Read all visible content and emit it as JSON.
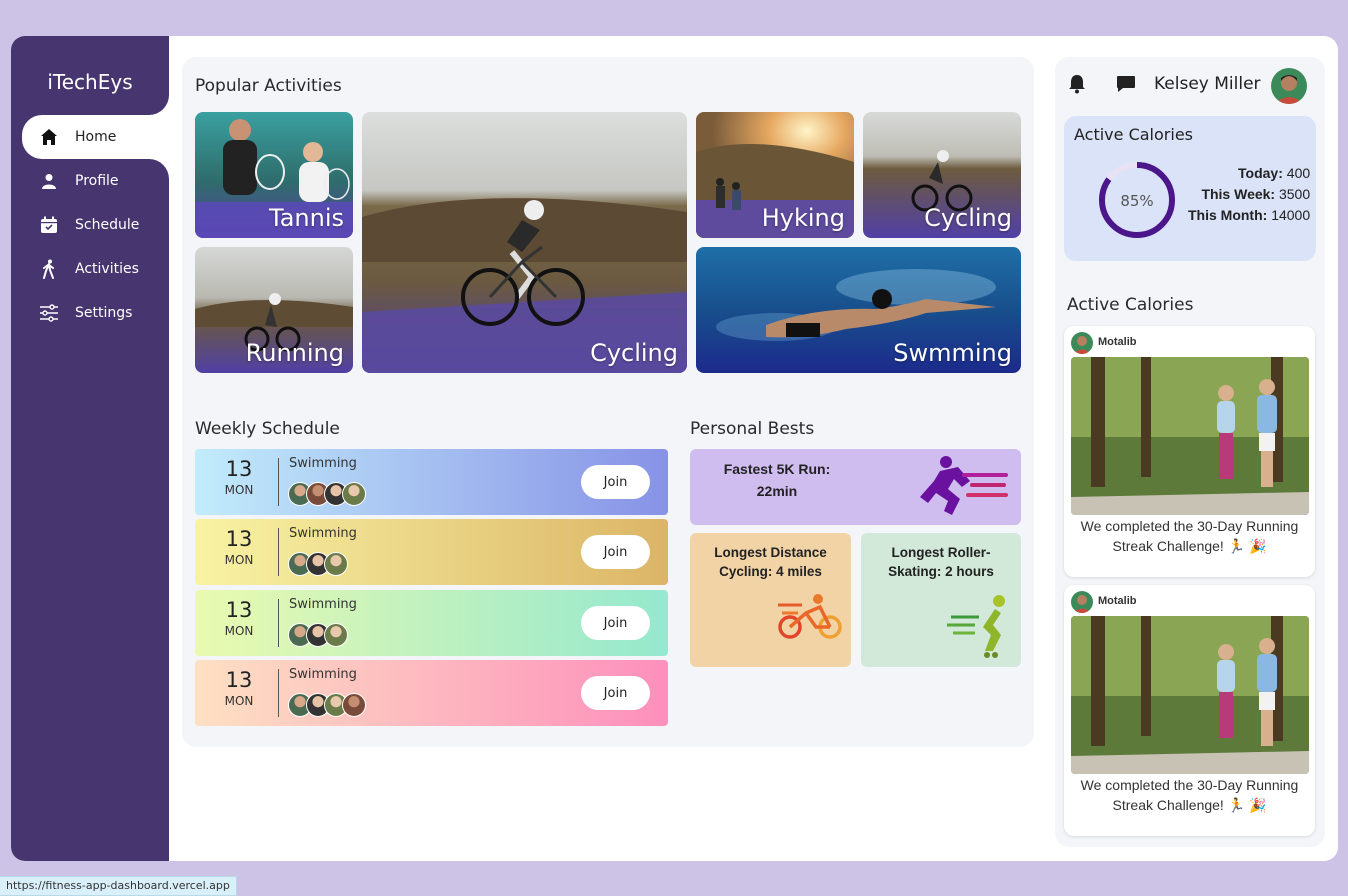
{
  "brand": "iTechEys",
  "nav": [
    {
      "label": "Home",
      "icon": "home-icon",
      "active": true
    },
    {
      "label": "Profile",
      "icon": "user-icon"
    },
    {
      "label": "Schedule",
      "icon": "calendar-icon"
    },
    {
      "label": "Activities",
      "icon": "walking-icon"
    },
    {
      "label": "Settings",
      "icon": "sliders-icon"
    }
  ],
  "popular": {
    "title": "Popular Activities",
    "tiles": [
      "Tannis",
      "Running",
      "Cycling",
      "Hyking",
      "Cycling",
      "Swmming"
    ]
  },
  "schedule": {
    "title": "Weekly Schedule",
    "rows": [
      {
        "day": "13",
        "dow": "MON",
        "activity": "Swimming",
        "join": "Join"
      },
      {
        "day": "13",
        "dow": "MON",
        "activity": "Swimming",
        "join": "Join"
      },
      {
        "day": "13",
        "dow": "MON",
        "activity": "Swimming",
        "join": "Join"
      },
      {
        "day": "13",
        "dow": "MON",
        "activity": "Swimming",
        "join": "Join"
      }
    ]
  },
  "bests": {
    "title": "Personal Bests",
    "fastest": "Fastest 5K Run: 22min",
    "distance": "Longest Distance Cycling: 4 miles",
    "skating": "Longest Roller-Skating: 2 hours"
  },
  "header": {
    "user_name": "Kelsey Miller"
  },
  "calories": {
    "title": "Active Calories",
    "percent": "85%",
    "percent_value": 0.85,
    "today_label": "Today:",
    "today": "400",
    "week_label": "This Week:",
    "week": "3500",
    "month_label": "This Month:",
    "month": "14000"
  },
  "feed": {
    "title": "Active Calories",
    "posts": [
      {
        "author": "Motalib",
        "text": "We completed the 30-Day Running Streak Challenge! 🏃 🎉"
      },
      {
        "author": "Motalib",
        "text": "We completed the 30-Day Running Streak Challenge! 🏃 🎉"
      }
    ]
  },
  "status_url": "https://fitness-app-dashboard.vercel.app",
  "colors": {
    "sidebar": "#47356f",
    "ring": "#4b168a",
    "page_bg": "#cdc3e6"
  }
}
